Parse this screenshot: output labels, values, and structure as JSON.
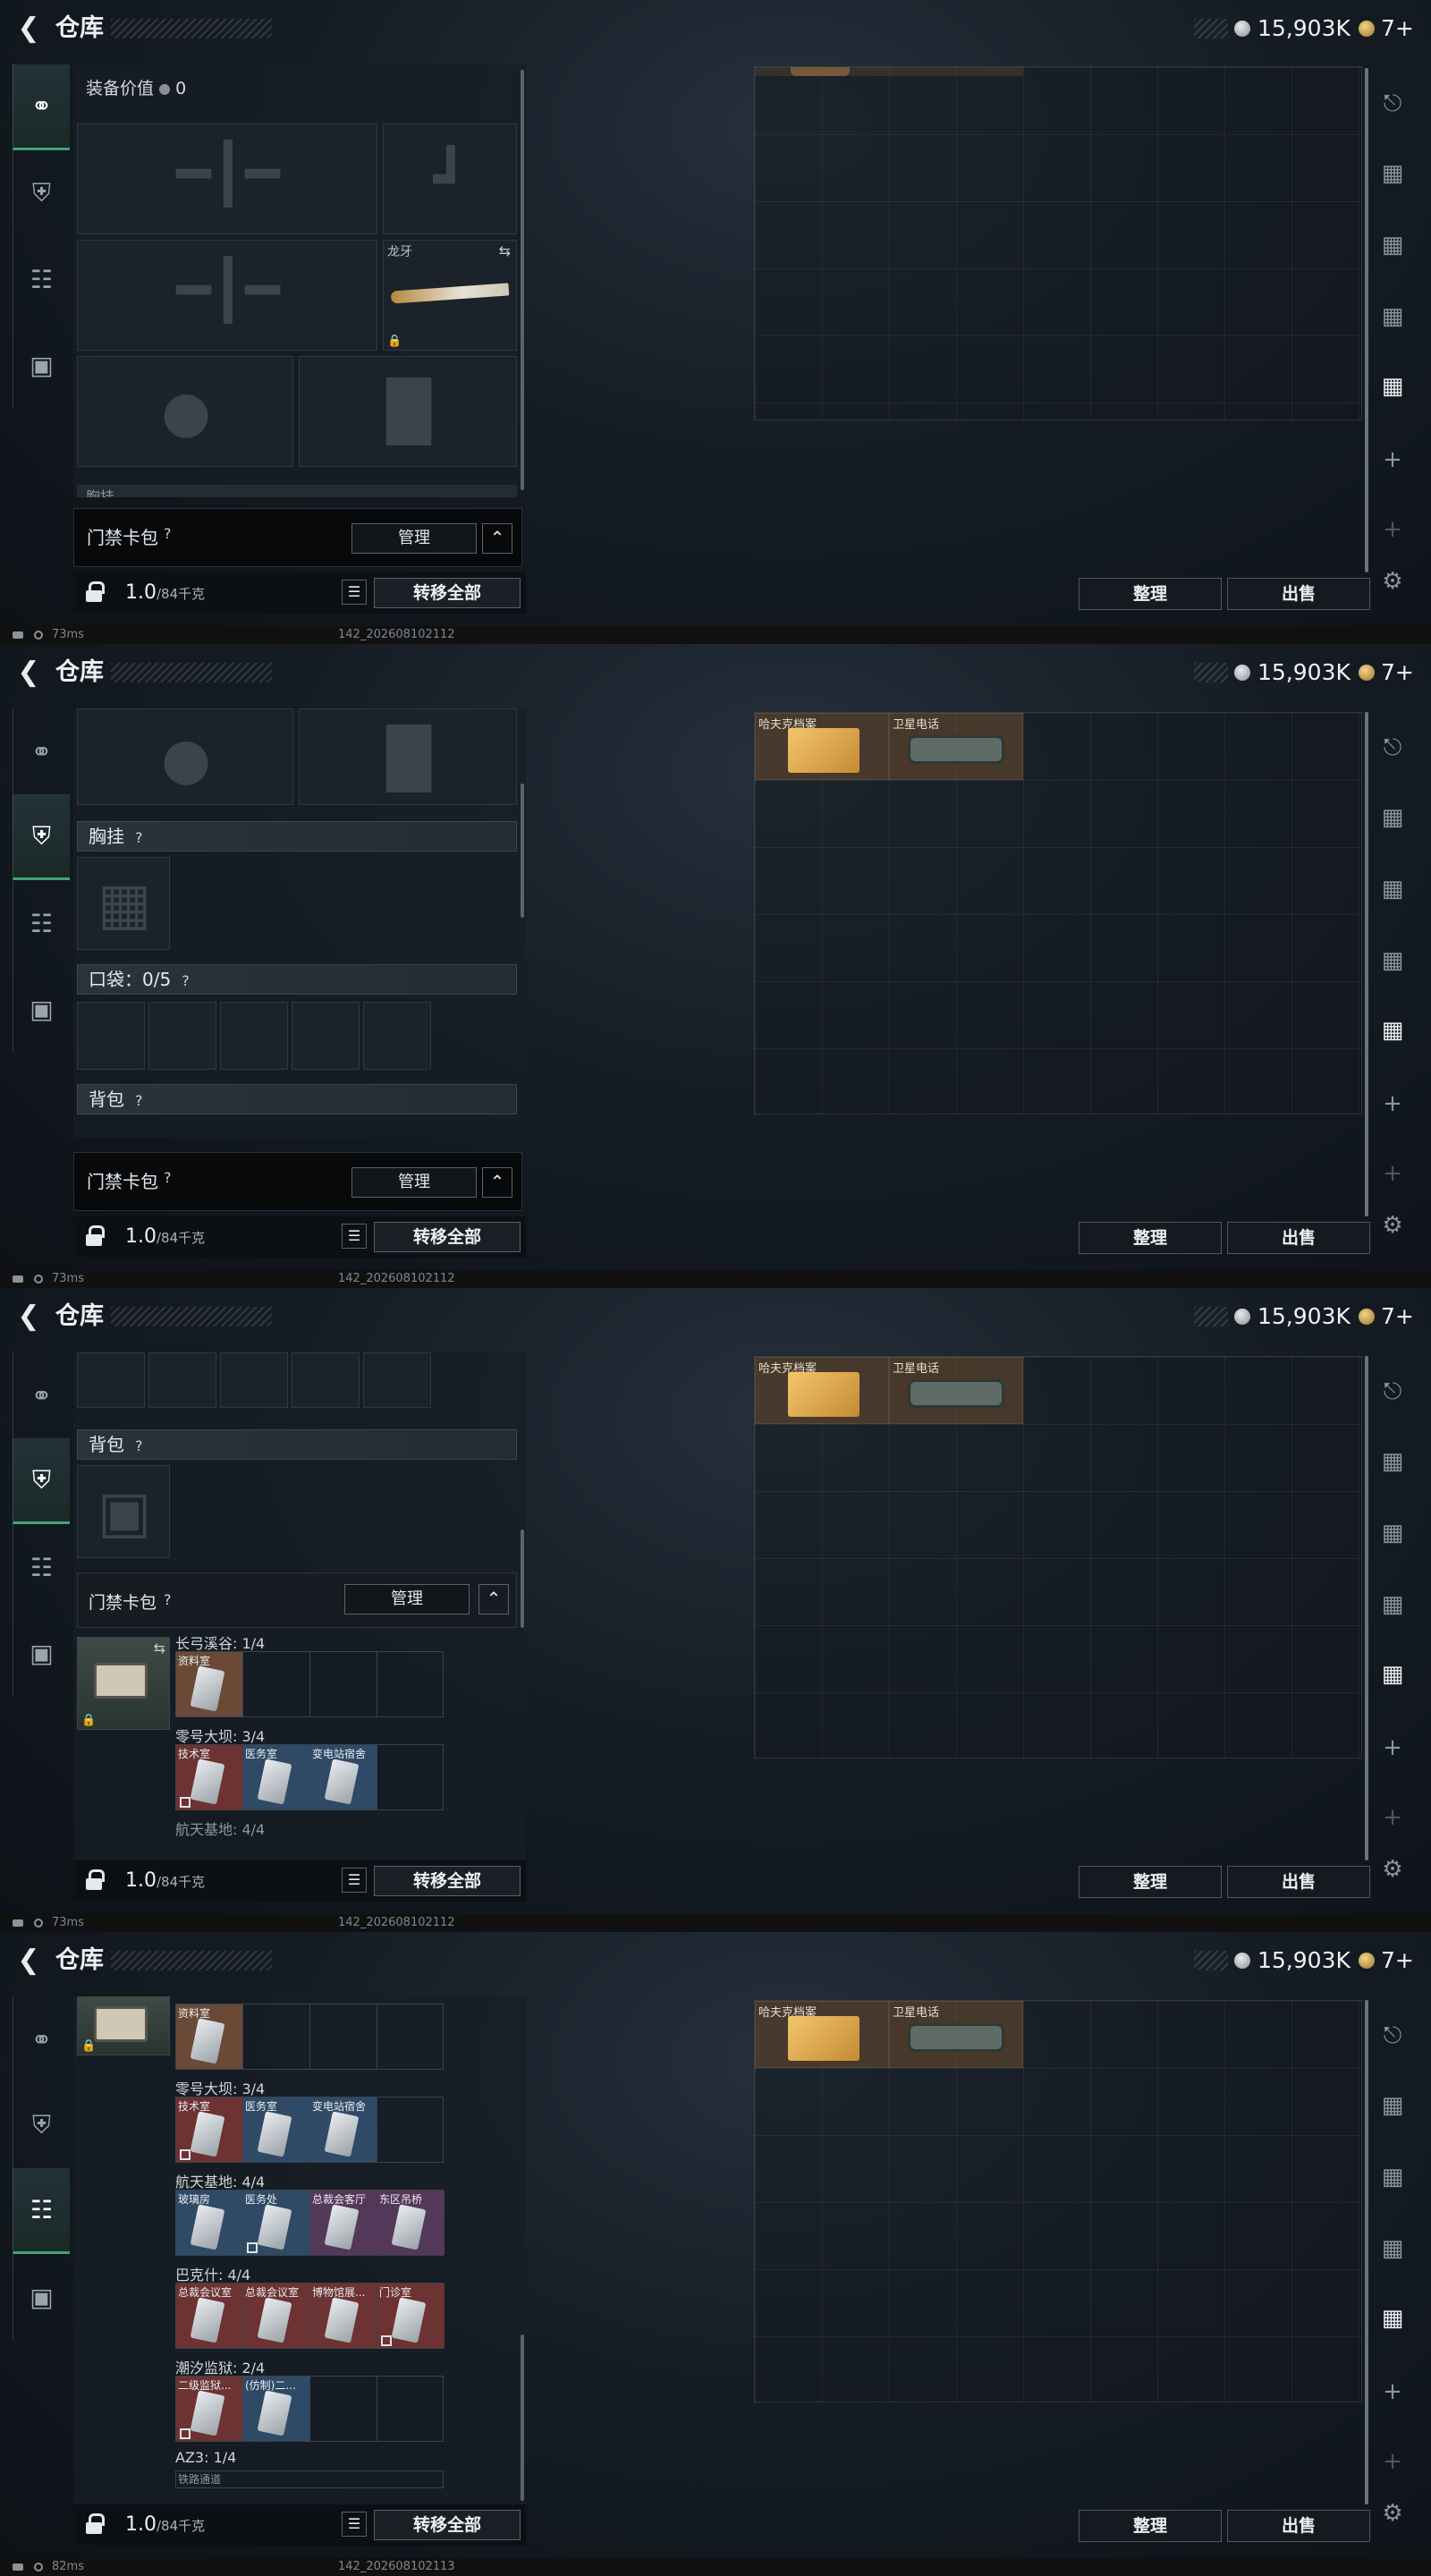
{
  "header": {
    "title": "仓库",
    "money": "15,903K",
    "tickets": "7+"
  },
  "loadout": {
    "equip_value_label": "装备价值",
    "equip_value": "0",
    "knife_label": "龙牙",
    "chest_rig": "胸挂",
    "pocket": "口袋：0/5",
    "backpack": "背包",
    "chest_rig_cut": "胸挂",
    "q": "?"
  },
  "keycard": {
    "label": "门禁卡包",
    "manage": "管理"
  },
  "maps": [
    {
      "name": "长弓溪谷: 1/4",
      "cells": [
        "资料室"
      ]
    },
    {
      "name": "零号大坝: 3/4",
      "cells": [
        "技术室",
        "医务室",
        "变电站宿舍"
      ]
    },
    {
      "name": "航天基地: 4/4",
      "cells": [
        "玻璃房",
        "医务处",
        "总裁会客厅",
        "东区吊桥"
      ]
    },
    {
      "name": "巴克什: 4/4",
      "cells": [
        "总裁会议室",
        "总裁会议室",
        "博物馆展...",
        "门诊室"
      ]
    },
    {
      "name": "潮汐监狱: 2/4",
      "cells": [
        "二级监狱...",
        "(仿制)二..."
      ]
    },
    {
      "name": "AZ3: 1/4",
      "cells": [
        "铁路通道"
      ]
    }
  ],
  "bottom": {
    "weight": "1.0",
    "weight_max": "/84千克",
    "move_all": "转移全部"
  },
  "grid_items": [
    {
      "label": "哈夫克档案"
    },
    {
      "label": "卫星电话"
    }
  ],
  "right_buttons": {
    "sort": "整理",
    "sell": "出售"
  },
  "status": [
    {
      "ping": "73ms",
      "version": "142_202608102112"
    },
    {
      "ping": "73ms",
      "version": "142_202608102112"
    },
    {
      "ping": "73ms",
      "version": "142_202608102112"
    },
    {
      "ping": "82ms",
      "version": "142_202608102113"
    }
  ],
  "icons": {
    "back": "back-arrow-icon",
    "gun": "gun-icon",
    "armor": "armor-icon",
    "clipboard": "clipboard-icon",
    "briefcase": "briefcase-icon",
    "settings": "gear-icon"
  }
}
